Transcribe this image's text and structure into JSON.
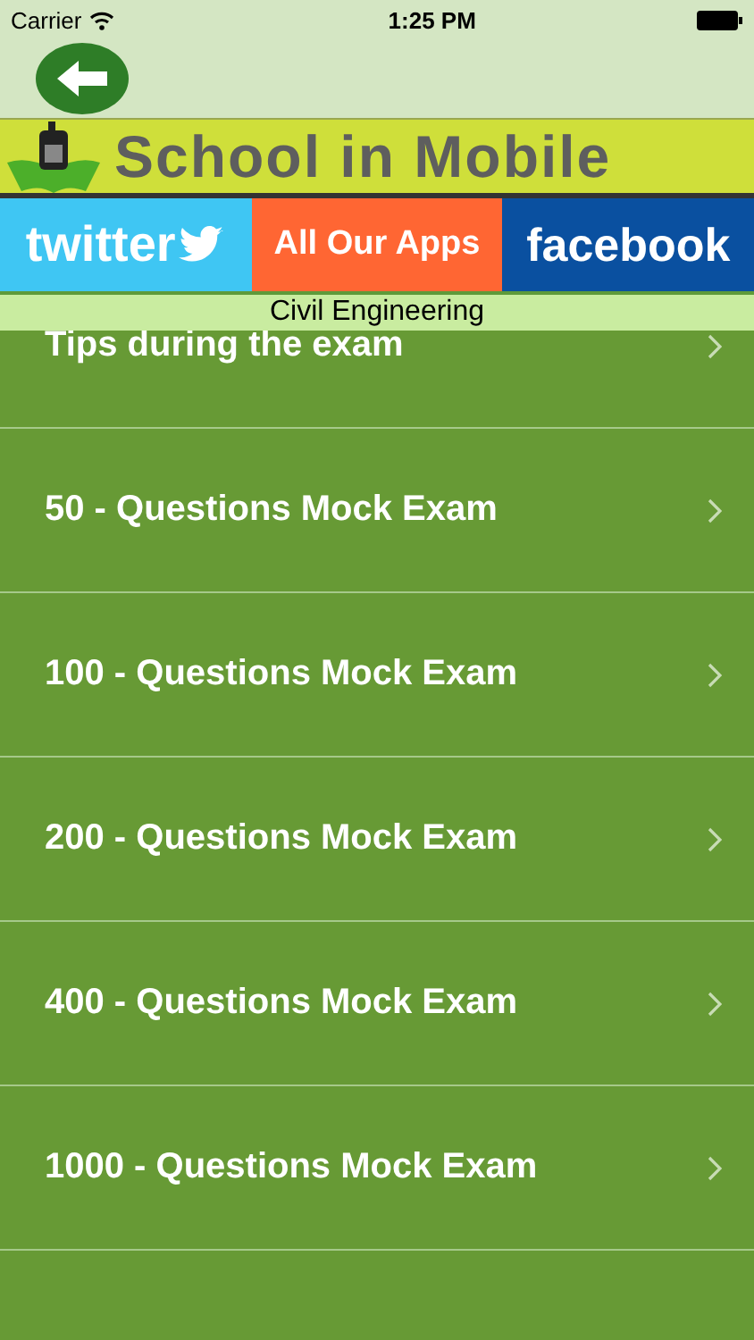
{
  "status_bar": {
    "carrier": "Carrier",
    "time": "1:25 PM"
  },
  "banner": {
    "title": "School in Mobile"
  },
  "social": [
    {
      "kind": "twitter",
      "label": "twitter"
    },
    {
      "kind": "apps",
      "label": "All Our Apps"
    },
    {
      "kind": "facebook",
      "label": "facebook"
    }
  ],
  "category": "Civil Engineering",
  "items": [
    {
      "label": "Tips during the exam"
    },
    {
      "label": "50 - Questions Mock Exam"
    },
    {
      "label": "100 - Questions Mock Exam"
    },
    {
      "label": "200 - Questions Mock Exam"
    },
    {
      "label": "400 - Questions Mock Exam"
    },
    {
      "label": "1000 - Questions Mock Exam"
    }
  ]
}
